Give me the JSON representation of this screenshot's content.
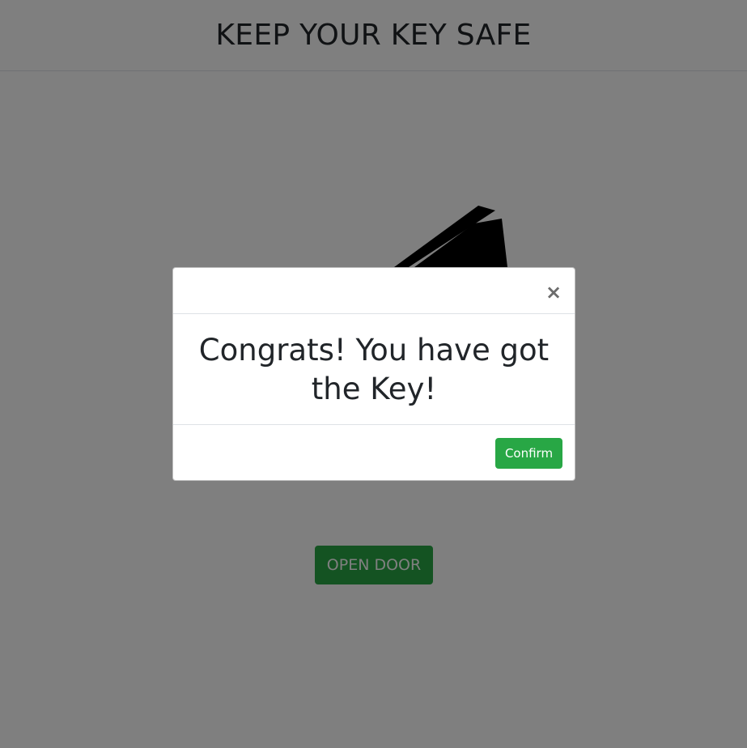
{
  "page": {
    "title": "KEEP YOUR KEY SAFE",
    "open_door_label": "OPEN DOOR",
    "key_icon": "key-icon"
  },
  "modal": {
    "close_label": "×",
    "message": "Congrats! You have got the Key!",
    "confirm_label": "Confirm"
  },
  "colors": {
    "accent": "#28a745",
    "text": "#212529",
    "backdrop": "#000000"
  }
}
